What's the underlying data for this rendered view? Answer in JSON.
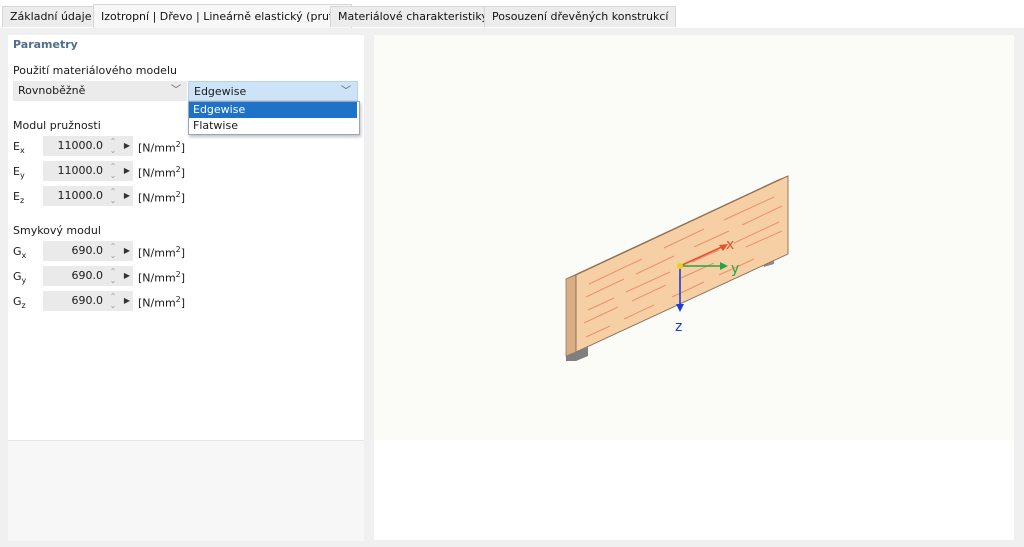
{
  "tabs": [
    {
      "label": "Základní údaje"
    },
    {
      "label": "Izotropní | Dřevo | Lineárně elastický (pruty)"
    },
    {
      "label": "Materiálové charakteristiky"
    },
    {
      "label": "Posouzení dřevěných konstrukcí"
    }
  ],
  "params": {
    "title": "Parametry",
    "model_label": "Použití materiálového modelu",
    "model_select": "Rovnoběžně",
    "orientation_select": "Edgewise",
    "dropdown_options": [
      "Edgewise",
      "Flatwise"
    ],
    "dropdown_selected": "Edgewise"
  },
  "elasticity": {
    "title": "Modul pružnosti",
    "rows": [
      {
        "sym": "E",
        "sub": "x",
        "value": "11000.0",
        "unit": "[N/mm",
        "exp": "2",
        "close": "]"
      },
      {
        "sym": "E",
        "sub": "y",
        "value": "11000.0",
        "unit": "[N/mm",
        "exp": "2",
        "close": "]"
      },
      {
        "sym": "E",
        "sub": "z",
        "value": "11000.0",
        "unit": "[N/mm",
        "exp": "2",
        "close": "]"
      }
    ]
  },
  "shear": {
    "title": "Smykový modul",
    "rows": [
      {
        "sym": "G",
        "sub": "x",
        "value": "690.0",
        "unit": "[N/mm",
        "exp": "2",
        "close": "]"
      },
      {
        "sym": "G",
        "sub": "y",
        "value": "690.0",
        "unit": "[N/mm",
        "exp": "2",
        "close": "]"
      },
      {
        "sym": "G",
        "sub": "z",
        "value": "690.0",
        "unit": "[N/mm",
        "exp": "2",
        "close": "]"
      }
    ]
  },
  "axes": {
    "x": "x",
    "y": "y",
    "z": "z"
  },
  "colors": {
    "accent_title": "#4e6e8e",
    "dropdown_highlight": "#1e73c8",
    "axis_x": "#e8502a",
    "axis_y": "#1ea84a",
    "axis_z": "#1a3fd6",
    "wood_face": "#f6cfa4",
    "wood_grain": "#f0906a"
  }
}
